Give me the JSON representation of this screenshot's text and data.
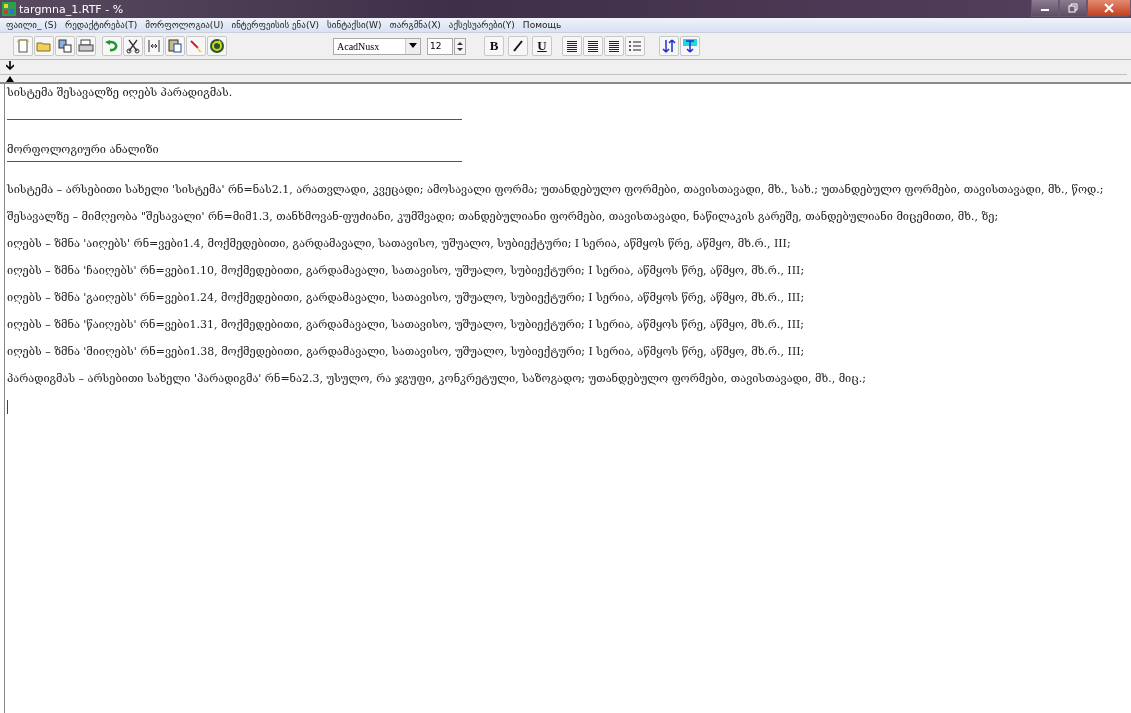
{
  "window": {
    "title": "targmna_1.RTF - %"
  },
  "menu": [
    "ფაილი_ (S)",
    "რედაქტირება(T)",
    "მორფოლოგია(U)",
    "ინტერფეისის ენა(V)",
    "სინტაქსი(W)",
    "თარგმნა(X)",
    "აქსესუარები(Y)",
    "Помощь"
  ],
  "toolbar": {
    "font": "AcadNusx",
    "size": "12",
    "format_buttons": [
      {
        "kind": "bold",
        "label": "B"
      },
      {
        "kind": "italic"
      },
      {
        "kind": "underline",
        "label": "U"
      }
    ]
  },
  "document": {
    "lines": [
      {
        "kind": "heading",
        "text": "სისტემა შესავალზე იღებს პარადიგმას."
      },
      {
        "kind": "rule"
      },
      {
        "kind": "heading",
        "text": "მორფოლოგიური ანალიზი"
      },
      {
        "kind": "rule"
      },
      {
        "kind": "entry",
        "text": "სისტემა – არსებითი სახელი 'სისტემა' რნ=ნას2.1, არათვლადი, კვეცადი; ამოსავალი ფორმა; უთანდებულო ფორმები, თავისთავადი, მხ., სახ.; უთანდებულო ფორმები, თავისთავადი, მხ., წოდ.;"
      },
      {
        "kind": "entry",
        "text": "შესავალზე – მიმღეობა \"შესავალი' რნ=მიმ1.3, თანხმოვან-ფუძიანი, კუმშვადი; თანდებულიანი ფორმები, თავისთავადი, ნაწილაკის გარეშე, თანდებულიანი მიცემითი, მხ., ზე;"
      },
      {
        "kind": "entry",
        "text": "იღებს – ზმნა 'აიღებს' რნ=ვები1.4, მოქმედებითი, გარდამავალი, სათავისო, უშუალო, სუბიექტური; I სერია, აწმყოს წრე, აწმყო, მხ.რ., III;"
      },
      {
        "kind": "entry",
        "text": "იღებს – ზმნა 'ჩაიღებს' რნ=ვები1.10, მოქმედებითი, გარდამავალი, სათავისო, უშუალო, სუბიექტური; I სერია, აწმყოს წრე, აწმყო, მხ.რ., III;"
      },
      {
        "kind": "entry",
        "text": "იღებს – ზმნა 'გაიღებს' რნ=ვები1.24, მოქმედებითი, გარდამავალი, სათავისო, უშუალო, სუბიექტური; I სერია, აწმყოს წრე, აწმყო, მხ.რ., III;"
      },
      {
        "kind": "entry",
        "text": "იღებს – ზმნა 'წაიღებს' რნ=ვები1.31, მოქმედებითი, გარდამავალი, სათავისო, უშუალო, სუბიექტური; I სერია, აწმყოს წრე, აწმყო, მხ.რ., III;"
      },
      {
        "kind": "entry",
        "text": "იღებს – ზმნა 'მიიღებს' რნ=ვები1.38, მოქმედებითი, გარდამავალი, სათავისო, უშუალო, სუბიექტური; I სერია, აწმყოს წრე, აწმყო, მხ.რ., III;"
      },
      {
        "kind": "entry",
        "text": "პარადიგმას – არსებითი სახელი 'პარადიგმა' რნ=ნა2.3, უსულო, რა ჯგუფი, კონკრეტული, საზოგადო; უთანდებულო ფორმები, თავისთავადი, მხ., მიც.;"
      }
    ]
  }
}
